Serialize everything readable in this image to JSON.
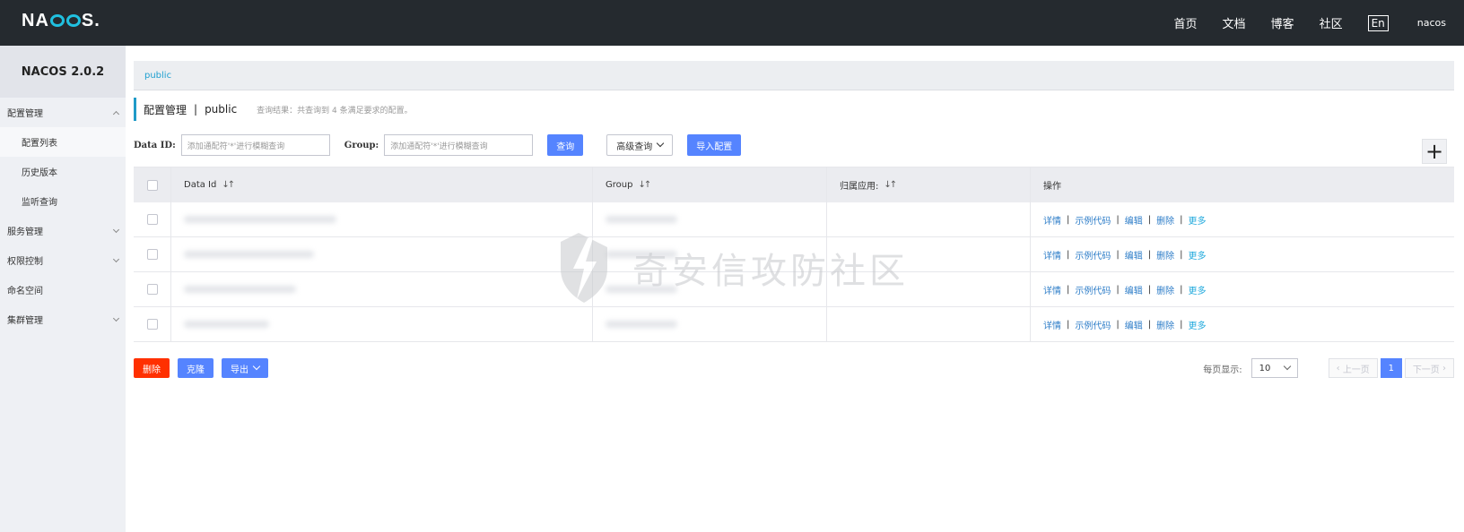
{
  "brand": {
    "logo_pre": "NA",
    "logo_post": "S.",
    "logo_mid": "C"
  },
  "topnav": {
    "items": [
      "首页",
      "文档",
      "博客",
      "社区"
    ],
    "lang": "En",
    "user": "nacos"
  },
  "sidebar": {
    "version": "NACOS 2.0.2",
    "items": [
      {
        "label": "配置管理"
      },
      {
        "label": "配置列表"
      },
      {
        "label": "历史版本"
      },
      {
        "label": "监听查询"
      },
      {
        "label": "服务管理"
      },
      {
        "label": "权限控制"
      },
      {
        "label": "命名空间"
      },
      {
        "label": "集群管理"
      }
    ]
  },
  "breadcrumb": "public",
  "header": {
    "title": "配置管理",
    "sep": "|",
    "namespace": "public",
    "result": "查询结果：共查询到 4 条满足要求的配置。"
  },
  "filters": {
    "dataid_label": "Data ID:",
    "dataid_placeholder": "添加通配符'*'进行模糊查询",
    "group_label": "Group:",
    "group_placeholder": "添加通配符'*'进行模糊查询",
    "query_button": "查询",
    "advanced_button": "高级查询",
    "import_button": "导入配置"
  },
  "table": {
    "columns": [
      "Data Id",
      "Group",
      "归属应用:",
      "操作"
    ],
    "sort_glyph": "↓↑",
    "ops": {
      "detail": "详情",
      "sample": "示例代码",
      "edit": "编辑",
      "delete": "删除",
      "more": "更多",
      "sep": "|"
    }
  },
  "bottom": {
    "delete": "删除",
    "clone": "克隆",
    "export": "导出"
  },
  "pager": {
    "page_size_label": "每页显示:",
    "page_size": "10",
    "prev": "上一页",
    "current": "1",
    "next": "下一页"
  },
  "watermark": "奇安信攻防社区",
  "colors": {
    "primary": "#5584ff",
    "danger": "#ff3000",
    "topbar": "#252a2f",
    "accent": "#209bc8"
  }
}
